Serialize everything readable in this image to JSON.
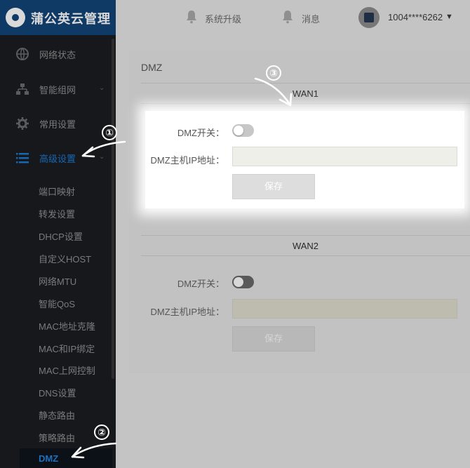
{
  "app": {
    "title": "蒲公英云管理"
  },
  "sidebar": {
    "items": [
      {
        "label": "网络状态",
        "icon": "globe-icon"
      },
      {
        "label": "智能组网",
        "icon": "network-icon",
        "chevron": "⌄"
      },
      {
        "label": "常用设置",
        "icon": "gear-icon"
      },
      {
        "label": "高级设置",
        "icon": "menu-icon",
        "chevron": "⌄",
        "active": true
      }
    ],
    "subitems": [
      "端口映射",
      "转发设置",
      "DHCP设置",
      "自定义HOST",
      "网络MTU",
      "智能QoS",
      "MAC地址克隆",
      "MAC和IP绑定",
      "MAC上网控制",
      "DNS设置",
      "静态路由",
      "策略路由",
      "DMZ"
    ],
    "current_subitem": "DMZ"
  },
  "header": {
    "upgrade": "系统升级",
    "messages": "消息",
    "user": "1004****6262",
    "caret": "▼"
  },
  "main": {
    "title": "DMZ",
    "sections": [
      {
        "name": "WAN1",
        "toggle_label": "DMZ开关：",
        "ip_label": "DMZ主机IP地址：",
        "ip_value": "",
        "save_label": "保存"
      },
      {
        "name": "WAN2",
        "toggle_label": "DMZ开关：",
        "ip_label": "DMZ主机IP地址：",
        "ip_value": "",
        "save_label": "保存"
      }
    ]
  },
  "annotations": [
    "①",
    "②",
    "③"
  ],
  "colors": {
    "sidebar_bg": "#17181c",
    "logo_bg": "#0f3a66",
    "accent": "#1768b3",
    "overlay": "#c4c4c4"
  }
}
